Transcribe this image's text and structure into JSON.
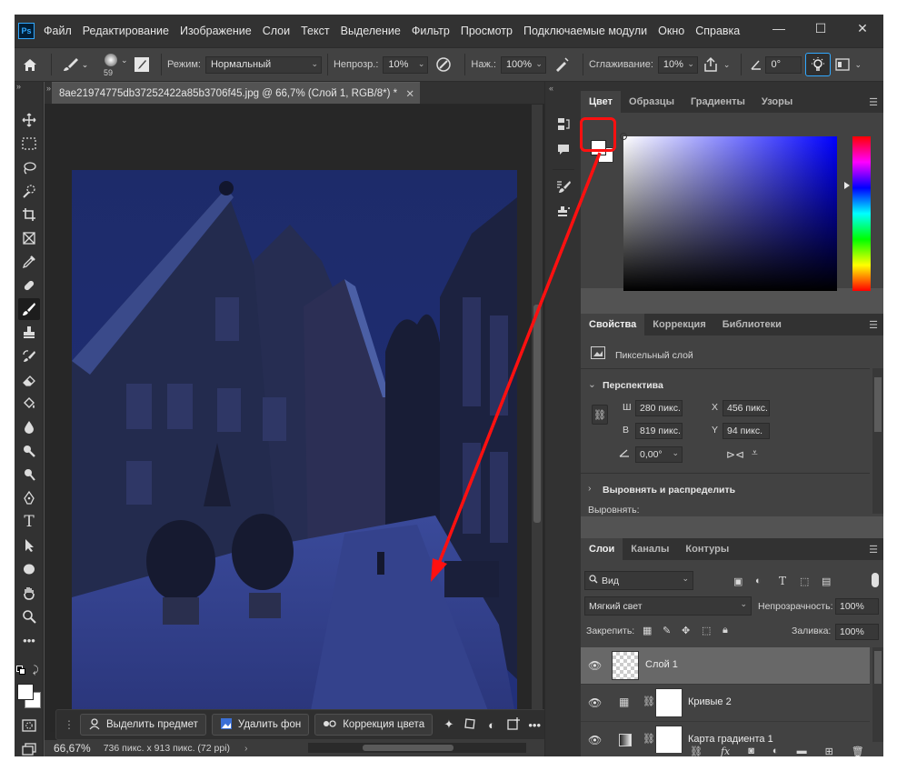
{
  "app": {
    "logo": "Ps"
  },
  "menu": [
    "Файл",
    "Редактирование",
    "Изображение",
    "Слои",
    "Текст",
    "Выделение",
    "Фильтр",
    "Просмотр",
    "Подключаемые модули",
    "Окно",
    "Справка"
  ],
  "window_controls": {
    "minimize": "—",
    "maximize": "☐",
    "close": "✕"
  },
  "options": {
    "brush_size": "59",
    "mode_label": "Режим:",
    "mode_value": "Нормальный",
    "opacity_label": "Непрозр.:",
    "opacity_value": "10%",
    "pressure_label": "Наж.:",
    "pressure_value": "100%",
    "smoothing_label": "Сглаживание:",
    "smoothing_value": "10%",
    "angle_value": "0°"
  },
  "document": {
    "tab_title": "8ae21974775db37252422a85b3706f45.jpg @ 66,7% (Слой 1, RGB/8*) *",
    "zoom": "66,67%",
    "size_info": "736 пикс. x 913 пикс. (72 ppi)"
  },
  "contextual_taskbar": {
    "select_subject": "Выделить предмет",
    "remove_bg": "Удалить фон",
    "color_correction": "Коррекция цвета"
  },
  "color_panel": {
    "tabs": [
      "Цвет",
      "Образцы",
      "Градиенты",
      "Узоры"
    ],
    "foreground": "#ffffff",
    "hue_color": "#0000ff"
  },
  "properties_panel": {
    "tabs": [
      "Свойства",
      "Коррекция",
      "Библиотеки"
    ],
    "layer_type": "Пиксельный слой",
    "section_transform": "Перспектива",
    "w_label": "Ш",
    "w_value": "280 пикс.",
    "h_label": "В",
    "h_value": "819 пикс.",
    "x_label": "X",
    "x_value": "456 пикс.",
    "y_label": "Y",
    "y_value": "94 пикс.",
    "angle_value": "0,00°",
    "section_align": "Выровнять и распределить",
    "align_label": "Выровнять:"
  },
  "layers_panel": {
    "tabs": [
      "Слои",
      "Каналы",
      "Контуры"
    ],
    "filter_kind": "Вид",
    "blend_mode": "Мягкий свет",
    "opacity_label": "Непрозрачность:",
    "opacity_value": "100%",
    "lock_label": "Закрепить:",
    "fill_label": "Заливка:",
    "fill_value": "100%",
    "layers": [
      {
        "name": "Слой 1"
      },
      {
        "name": "Кривые 2"
      },
      {
        "name": "Карта градиента 1"
      }
    ]
  },
  "colors": {
    "annotation": "#ff1010",
    "ps_blue": "#31a8ff"
  }
}
